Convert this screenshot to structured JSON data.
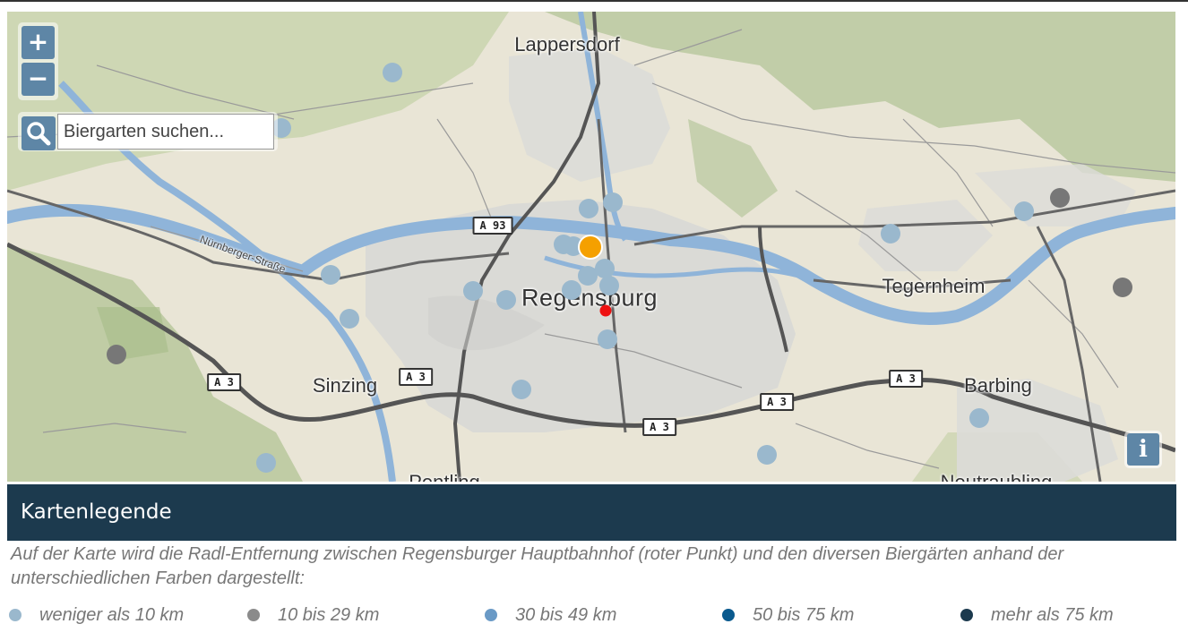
{
  "map": {
    "places": [
      {
        "name": "Lappersdorf"
      },
      {
        "name": "Regensburg"
      },
      {
        "name": "Tegernheim"
      },
      {
        "name": "Sinzing"
      },
      {
        "name": "Barbing"
      },
      {
        "name": "Pentling"
      },
      {
        "name": "Neutraubling"
      }
    ],
    "street_label": "Nürnberger-Straße",
    "highway_badges": [
      "A 93",
      "A 3",
      "A 3",
      "A 3",
      "A 3",
      "A 3"
    ],
    "zoom_in_label": "+",
    "zoom_out_label": "−",
    "search_placeholder": "Biergarten suchen...",
    "info_label": "i",
    "markers": {
      "station": {
        "color": "#ee1111",
        "label": "Hauptbahnhof"
      },
      "highlight": {
        "color": "#f5a000"
      },
      "light": {
        "color": "#9ab8cd"
      },
      "grey": {
        "color": "#777777"
      }
    }
  },
  "legend": {
    "title": "Kartenlegende",
    "description": "Auf der Karte wird die Radl-Entfernung zwischen Regensburger Hauptbahnhof (roter Punkt) und den diversen Biergärten anhand der unterschiedlichen Farben dargestellt:",
    "items": [
      {
        "label": "weniger als 10 km",
        "color": "#9ab8cd"
      },
      {
        "label": "10 bis 29 km",
        "color": "#8b8b8b"
      },
      {
        "label": "30 bis 49 km",
        "color": "#6a9ac6"
      },
      {
        "label": "50 bis 75 km",
        "color": "#0a5a8e"
      },
      {
        "label": "mehr als 75 km",
        "color": "#1c3a4e"
      }
    ]
  }
}
